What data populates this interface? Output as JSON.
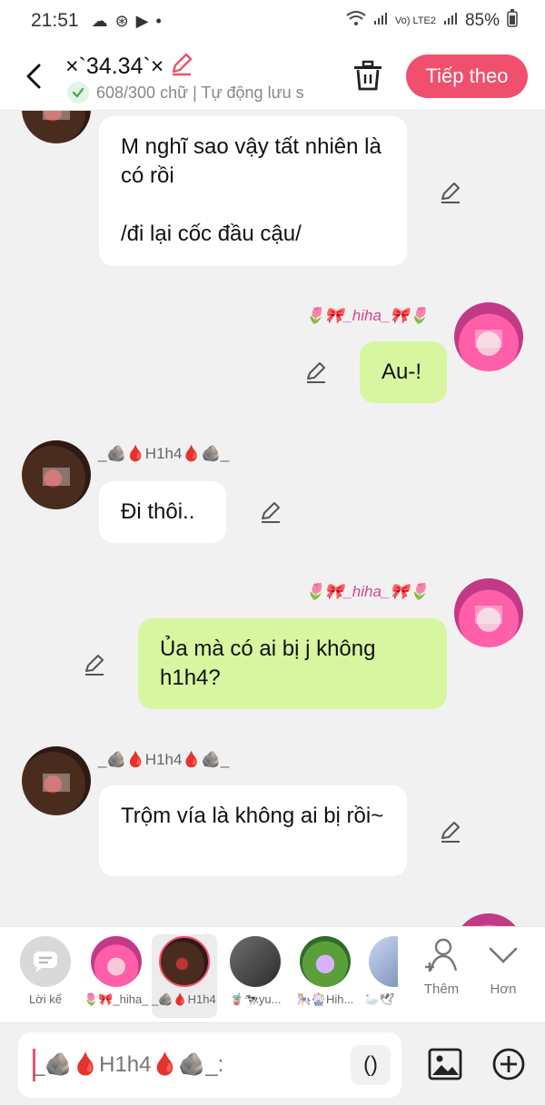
{
  "status_bar": {
    "time": "21:51",
    "left_icons": [
      "cloud-icon",
      "compass-icon",
      "youtube-icon",
      "dot-icon"
    ],
    "network": "Vo) LTE2",
    "battery": "85%"
  },
  "header": {
    "title": "×`34.34`×",
    "word_count": "608/300 chữ | Tự động lưu s",
    "next_label": "Tiếp theo"
  },
  "messages": [
    {
      "sender": "other",
      "name": "",
      "text": "M nghĩ sao vậy tất nhiên là có rồi\n\n/đi lại cốc đầu cậu/"
    },
    {
      "sender": "me",
      "name": "🌷🎀_hiha_🎀🌷",
      "text": "Au-!"
    },
    {
      "sender": "other",
      "name": "_🪨🩸H1h4🩸🪨_",
      "text": "Đi thôi.."
    },
    {
      "sender": "me",
      "name": "🌷🎀_hiha_🎀🌷",
      "text": "Ủa mà có ai bị j không h1h4?"
    },
    {
      "sender": "other",
      "name": "_🪨🩸H1h4🩸🪨_",
      "text": "Trộm vía là không ai bị rồi~"
    }
  ],
  "character_tray": {
    "storyteller_label": "Lời kể",
    "characters": [
      {
        "label": "🌷🎀_hiha_🎀🌷",
        "selected": false
      },
      {
        "label": "_🪨🩸H1h4🩸🪨_",
        "selected": true
      },
      {
        "label": "🧋🐄yu...",
        "selected": false
      },
      {
        "label": "🎠🎡Hih...",
        "selected": false
      },
      {
        "label": "🦢🕊",
        "selected": false
      }
    ],
    "add_label": "Thêm",
    "more_label": "Hơn"
  },
  "composer": {
    "placeholder": "_🪨🩸H1h4🩸🪨_:",
    "parens_label": "()"
  },
  "colors": {
    "accent": "#f0506e",
    "my_bubble": "#d8f6a0",
    "other_bubble": "#ffffff",
    "background": "#f1f1f1"
  }
}
